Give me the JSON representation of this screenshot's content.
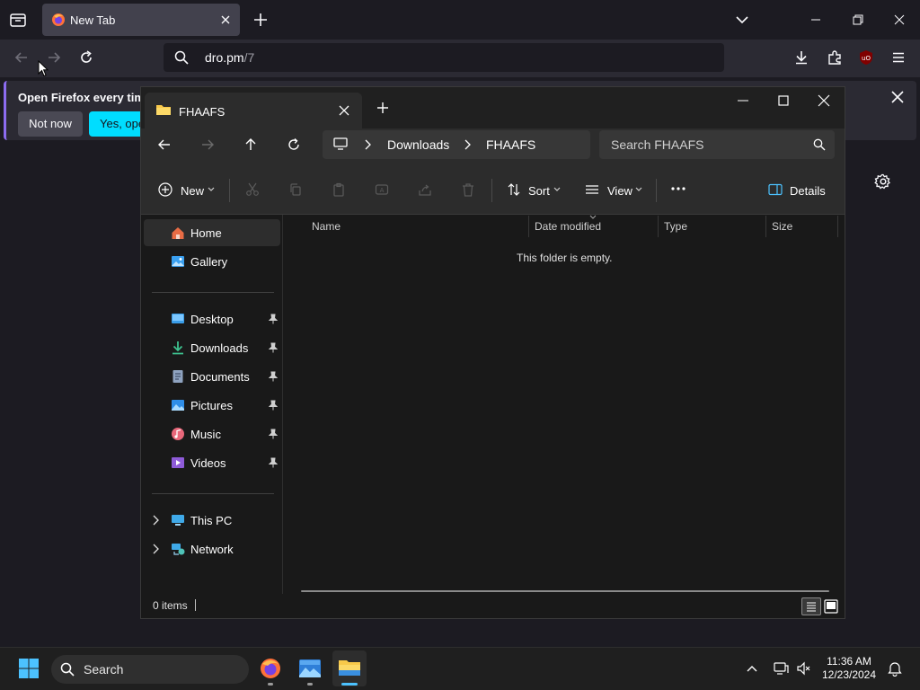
{
  "firefox": {
    "tab_title": "New Tab",
    "url_host": "dro.pm",
    "url_path": "/7",
    "notification": {
      "message": "Open Firefox every time",
      "not_now_label": "Not now",
      "yes_label": "Yes, open"
    }
  },
  "explorer": {
    "tab_title": "FHAAFS",
    "breadcrumb": [
      "Downloads",
      "FHAAFS"
    ],
    "search_placeholder": "Search FHAAFS",
    "toolbar": {
      "new_label": "New",
      "sort_label": "Sort",
      "view_label": "View",
      "details_label": "Details"
    },
    "nav": {
      "home": "Home",
      "gallery": "Gallery",
      "quick_access": [
        {
          "label": "Desktop"
        },
        {
          "label": "Downloads"
        },
        {
          "label": "Documents"
        },
        {
          "label": "Pictures"
        },
        {
          "label": "Music"
        },
        {
          "label": "Videos"
        }
      ],
      "this_pc": "This PC",
      "network": "Network"
    },
    "columns": [
      "Name",
      "Date modified",
      "Type",
      "Size"
    ],
    "empty_message": "This folder is empty.",
    "status_count": "0 items"
  },
  "taskbar": {
    "search_label": "Search",
    "time": "11:36 AM",
    "date": "12/23/2024"
  },
  "colors": {
    "firefox_accent": "#00ddff",
    "explorer_folder": "#f8c94a",
    "taskbar_active": "#4cc2ff"
  }
}
